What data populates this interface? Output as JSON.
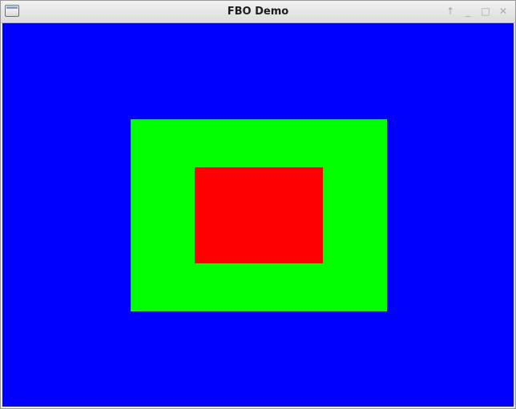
{
  "window": {
    "title": "FBO Demo",
    "controls": {
      "above_icon": "↑",
      "minimize_icon": "_",
      "maximize_icon": "□",
      "close_icon": "✕"
    }
  },
  "canvas": {
    "background_color": "#0000ff",
    "outer_rect_color": "#00ff00",
    "inner_rect_color": "#ff0000"
  }
}
